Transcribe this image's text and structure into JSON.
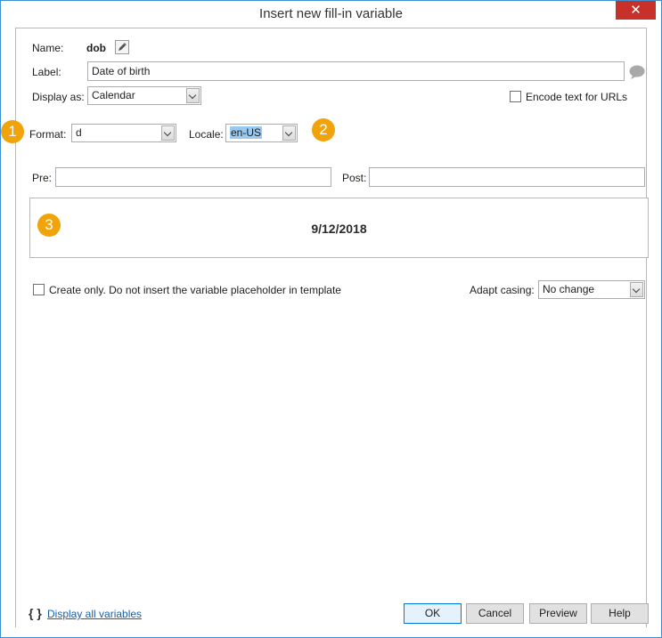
{
  "window": {
    "title": "Insert new fill-in variable",
    "close_glyph": "✕"
  },
  "form": {
    "name_label": "Name:",
    "name_value": "dob",
    "label_label": "Label:",
    "label_value": "Date of birth",
    "display_as_label": "Display as:",
    "display_as_value": "Calendar",
    "encode_label": "Encode text for URLs",
    "format_label": "Format:",
    "format_value": "d",
    "locale_label": "Locale:",
    "locale_value": "en-US",
    "pre_label": "Pre:",
    "pre_value": "",
    "post_label": "Post:",
    "post_value": "",
    "preview_value": "9/12/2018",
    "create_only_label": "Create only. Do not insert the variable placeholder in template",
    "adapt_casing_label": "Adapt casing:",
    "adapt_casing_value": "No change"
  },
  "badges": [
    "1",
    "2",
    "3"
  ],
  "footer": {
    "braces": "{ }",
    "display_all_link": "Display all variables",
    "ok": "OK",
    "cancel": "Cancel",
    "preview": "Preview",
    "help": "Help"
  },
  "colors": {
    "accent": "#3c8fd1",
    "close": "#c7312a",
    "badge": "#f0a30a",
    "link": "#1a5ea8",
    "selection": "#99c9ef"
  }
}
